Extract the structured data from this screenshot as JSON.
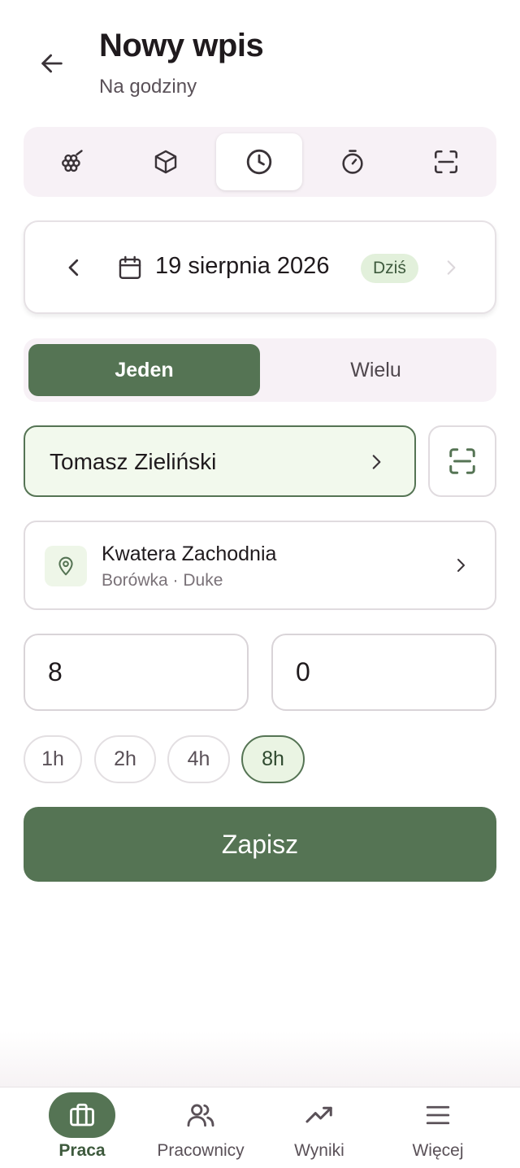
{
  "header": {
    "title": "Nowy wpis",
    "subtitle": "Na godziny"
  },
  "mode_tabs": [
    {
      "icon": "grapes-icon"
    },
    {
      "icon": "box-icon"
    },
    {
      "icon": "clock-icon",
      "active": true
    },
    {
      "icon": "stopwatch-icon"
    },
    {
      "icon": "scan-icon"
    }
  ],
  "date": {
    "label": "19 sierpnia 2026",
    "today_badge": "Dziś"
  },
  "segment": {
    "single": "Jeden",
    "multiple": "Wielu",
    "selected": "single"
  },
  "worker": {
    "name": "Tomasz Zieliński"
  },
  "location": {
    "title": "Kwatera Zachodnia",
    "subtitle": "Borówka · Duke"
  },
  "inputs": {
    "hours": "8",
    "minutes": "0"
  },
  "quick_hours": [
    "1h",
    "2h",
    "4h",
    "8h"
  ],
  "quick_hours_selected": "8h",
  "save_label": "Zapisz",
  "nav": [
    {
      "label": "Praca",
      "icon": "briefcase-icon",
      "active": true
    },
    {
      "label": "Pracownicy",
      "icon": "users-icon"
    },
    {
      "label": "Wyniki",
      "icon": "trending-up-icon"
    },
    {
      "label": "Więcej",
      "icon": "menu-icon"
    }
  ],
  "colors": {
    "primary": "#557454",
    "accent_bg": "#f2f9ed",
    "surface": "#f7f1f6",
    "badge_bg": "#e2f0db"
  }
}
